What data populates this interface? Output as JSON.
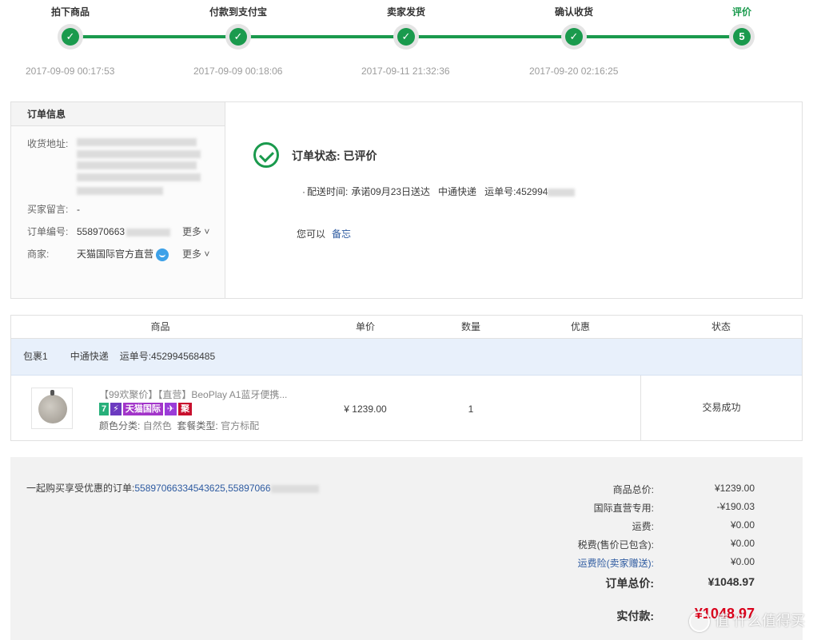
{
  "progress": {
    "steps": [
      {
        "label": "拍下商品",
        "mark": "✓",
        "time": "2017-09-09 00:17:53"
      },
      {
        "label": "付款到支付宝",
        "mark": "✓",
        "time": "2017-09-09 00:18:06"
      },
      {
        "label": "卖家发货",
        "mark": "✓",
        "time": "2017-09-11 21:32:36"
      },
      {
        "label": "确认收货",
        "mark": "✓",
        "time": "2017-09-20 02:16:25"
      },
      {
        "label": "评价",
        "mark": "5",
        "time": ""
      }
    ],
    "active_color": "#1a9a4d"
  },
  "order_info": {
    "heading": "订单信息",
    "address_label": "收货地址:",
    "message_label": "买家留言:",
    "message_value": "-",
    "order_no_label": "订单编号:",
    "order_no_value": "558970663",
    "more_label": "更多",
    "merchant_label": "商家:",
    "merchant_value": "天猫国际官方直营",
    "merchant_more_label": "更多"
  },
  "status": {
    "title": "订单状态: 已评价",
    "delivery_label": "配送时间:",
    "delivery_promise": "承诺09月23日送达",
    "carrier": "中通快递",
    "tracking_label": "运单号:",
    "tracking_value": "452994",
    "can_do_label": "您可以",
    "memo_link": "备忘"
  },
  "goods_table": {
    "headers": [
      "商品",
      "单价",
      "数量",
      "优惠",
      "状态"
    ],
    "package": {
      "name": "包裹1",
      "carrier": "中通快递",
      "tracking": "运单号:452994568485"
    },
    "item": {
      "title": "【99欢聚价】【直营】BeoPlay A1蓝牙便携...",
      "badges": [
        "7",
        "⚡",
        "天猫国际",
        "✈",
        "聚"
      ],
      "color_label": "颜色分类:",
      "color_value": "自然色",
      "package_label": "套餐类型:",
      "package_value": "官方标配",
      "price": "¥ 1239.00",
      "quantity": "1",
      "discount": "",
      "status": "交易成功"
    }
  },
  "summary": {
    "combine_label": "一起购买享受优惠的订单:",
    "combine_orders": "55897066334543625,55897066",
    "rows": [
      {
        "label": "商品总价:",
        "value": "¥1239.00"
      },
      {
        "label": "国际直营专用:",
        "value": "-¥190.03"
      },
      {
        "label": "运费:",
        "value": "¥0.00"
      },
      {
        "label": "税费(售价已包含):",
        "value": "¥0.00"
      },
      {
        "label": "运费险(卖家赠送):",
        "value": "¥0.00"
      }
    ],
    "total_label": "订单总价:",
    "total_value": "¥1048.97",
    "paid_label": "实付款:",
    "paid_value": "¥1048.97",
    "accent_red": "#d9001b"
  },
  "watermark": "值 什么值得买"
}
